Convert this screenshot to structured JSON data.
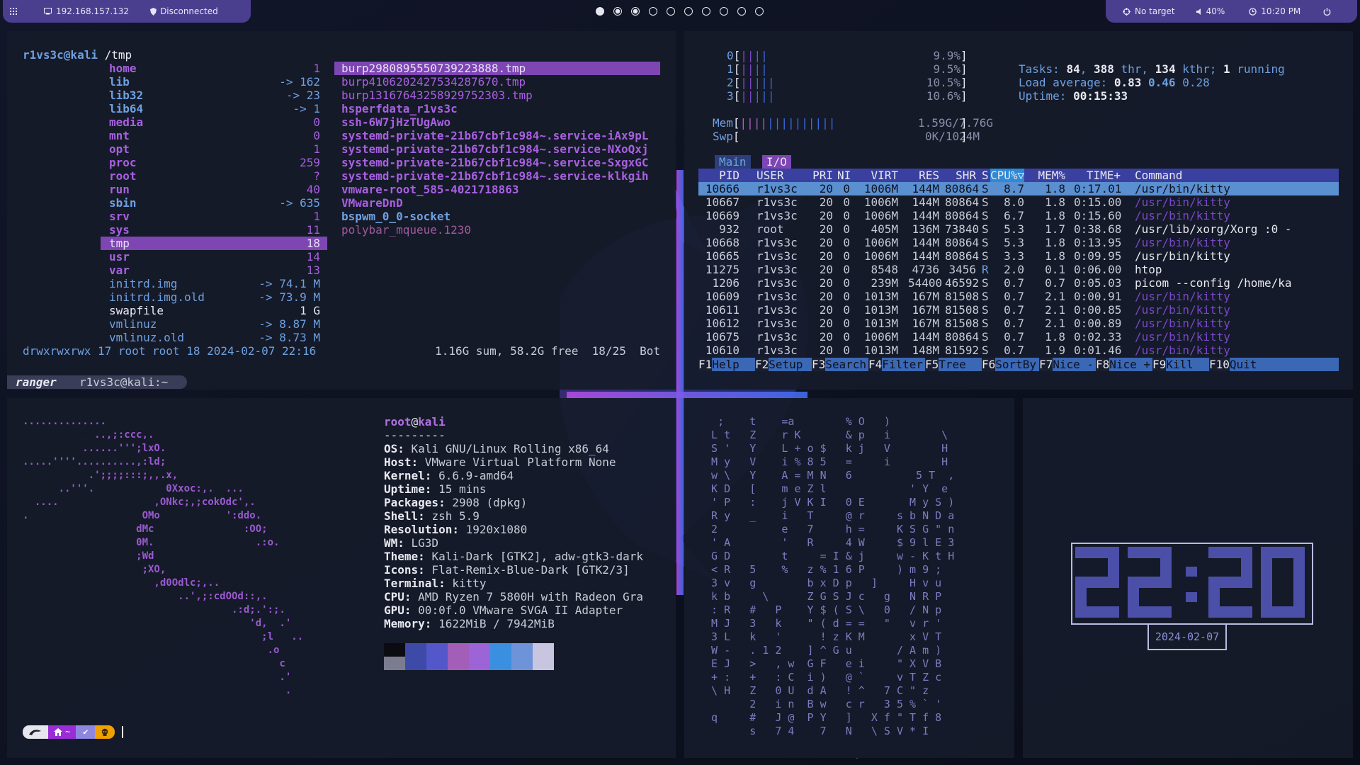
{
  "topbar": {
    "ip": "192.168.157.132",
    "vpn": "Disconnected",
    "target": "No target",
    "volume": "40%",
    "time": "10:20 PM",
    "workspaces": 10
  },
  "ranger": {
    "prompt_user": "r1vs3c@kali",
    "prompt_path": "/tmp",
    "left": [
      [
        "home",
        "1"
      ],
      [
        "lib",
        "-> 162"
      ],
      [
        "lib32",
        "-> 23"
      ],
      [
        "lib64",
        "-> 1"
      ],
      [
        "media",
        "0"
      ],
      [
        "mnt",
        "0"
      ],
      [
        "opt",
        "1"
      ],
      [
        "proc",
        "259"
      ],
      [
        "root",
        "?"
      ],
      [
        "run",
        "40"
      ],
      [
        "sbin",
        "-> 635"
      ],
      [
        "srv",
        "1"
      ],
      [
        "sys",
        "11"
      ],
      [
        "tmp",
        "18"
      ],
      [
        "usr",
        "14"
      ],
      [
        "var",
        "13"
      ],
      [
        "initrd.img",
        "-> 74.1 M"
      ],
      [
        "initrd.img.old",
        "-> 73.9 M"
      ],
      [
        "swapfile",
        "1 G"
      ],
      [
        "vmlinuz",
        "-> 8.87 M"
      ],
      [
        "vmlinuz.old",
        "-> 8.73 M"
      ]
    ],
    "right": [
      "burp2980895550739223888.tmp",
      "burp4106202427534287670.tmp",
      "burp13167643258929752303.tmp",
      "hsperfdata_r1vs3c",
      "ssh-6W7jHzTUgAwo",
      "systemd-private-21b67cbf1c984~.service-iAx9pL",
      "systemd-private-21b67cbf1c984~.service-NXoQxj",
      "systemd-private-21b67cbf1c984~.service-SxgxGC",
      "systemd-private-21b67cbf1c984~.service-klkgih",
      "vmware-root_585-4021718863",
      "VMwareDnD",
      "bspwm_0_0-socket",
      "polybar_mqueue.1230"
    ],
    "status_left": "drwxrwxrwx 17 root root 18 2024-02-07 22:16",
    "status_right": "1.16G sum, 58.2G free  18/25  Bot",
    "tab_name": "ranger",
    "tab_title": "r1vs3c@kali:~"
  },
  "htop": {
    "cpus": [
      [
        "0",
        "9.9%"
      ],
      [
        "1",
        "9.5%"
      ],
      [
        "2",
        "10.5%"
      ],
      [
        "3",
        "10.6%"
      ]
    ],
    "mem": "1.59G/7.76G",
    "swp": "0K/1024M",
    "tasks": "84",
    "thr": "388",
    "kthr": "134",
    "running": "1",
    "load1": "0.83",
    "load5": "0.46",
    "load15": "0.28",
    "uptime": "00:15:33",
    "tabs": [
      "Main",
      "I/O"
    ],
    "headers": [
      "PID",
      "USER",
      "PRI",
      "NI",
      "VIRT",
      "RES",
      "SHR",
      "S",
      "CPU%▽",
      "MEM%",
      "TIME+",
      "Command"
    ],
    "rows": [
      [
        "10666",
        "r1vs3c",
        "20",
        "0",
        "1006M",
        "144M",
        "80864",
        "S",
        "8.7",
        "1.8",
        "0:17.01",
        "/usr/bin/kitty"
      ],
      [
        "10667",
        "r1vs3c",
        "20",
        "0",
        "1006M",
        "144M",
        "80864",
        "S",
        "8.0",
        "1.8",
        "0:15.00",
        "/usr/bin/kitty"
      ],
      [
        "10669",
        "r1vs3c",
        "20",
        "0",
        "1006M",
        "144M",
        "80864",
        "S",
        "6.7",
        "1.8",
        "0:15.60",
        "/usr/bin/kitty"
      ],
      [
        "932",
        "root",
        "20",
        "0",
        "405M",
        "136M",
        "73840",
        "S",
        "5.3",
        "1.7",
        "0:38.68",
        "/usr/lib/xorg/Xorg :0 -"
      ],
      [
        "10668",
        "r1vs3c",
        "20",
        "0",
        "1006M",
        "144M",
        "80864",
        "S",
        "5.3",
        "1.8",
        "0:13.95",
        "/usr/bin/kitty"
      ],
      [
        "10665",
        "r1vs3c",
        "20",
        "0",
        "1006M",
        "144M",
        "80864",
        "S",
        "3.3",
        "1.8",
        "0:09.95",
        "/usr/bin/kitty"
      ],
      [
        "11275",
        "r1vs3c",
        "20",
        "0",
        "8548",
        "4736",
        "3456",
        "R",
        "2.0",
        "0.1",
        "0:06.00",
        "htop"
      ],
      [
        "1206",
        "r1vs3c",
        "20",
        "0",
        "239M",
        "54400",
        "46592",
        "S",
        "0.7",
        "0.7",
        "0:05.03",
        "picom --config /home/ka"
      ],
      [
        "10609",
        "r1vs3c",
        "20",
        "0",
        "1013M",
        "167M",
        "81508",
        "S",
        "0.7",
        "2.1",
        "0:00.91",
        "/usr/bin/kitty"
      ],
      [
        "10611",
        "r1vs3c",
        "20",
        "0",
        "1013M",
        "167M",
        "81508",
        "S",
        "0.7",
        "2.1",
        "0:00.85",
        "/usr/bin/kitty"
      ],
      [
        "10612",
        "r1vs3c",
        "20",
        "0",
        "1013M",
        "167M",
        "81508",
        "S",
        "0.7",
        "2.1",
        "0:00.89",
        "/usr/bin/kitty"
      ],
      [
        "10675",
        "r1vs3c",
        "20",
        "0",
        "1006M",
        "144M",
        "80864",
        "S",
        "0.7",
        "1.8",
        "0:02.33",
        "/usr/bin/kitty"
      ],
      [
        "10610",
        "r1vs3c",
        "20",
        "0",
        "1013M",
        "148M",
        "81592",
        "S",
        "0.7",
        "1.9",
        "0:01.46",
        "/usr/bin/kitty"
      ]
    ],
    "fkeys": [
      [
        "F1",
        "Help"
      ],
      [
        "F2",
        "Setup"
      ],
      [
        "F3",
        "Search"
      ],
      [
        "F4",
        "Filter"
      ],
      [
        "F5",
        "Tree"
      ],
      [
        "F6",
        "SortBy"
      ],
      [
        "F7",
        "Nice -"
      ],
      [
        "F8",
        "Nice +"
      ],
      [
        "F9",
        "Kill"
      ],
      [
        "F10",
        "Quit"
      ]
    ]
  },
  "neofetch": {
    "logo": [
      "..............",
      "            ..,;:ccc,.",
      "          ......''';lxO.",
      ".....''''..........,:ld;",
      "           .';;;;:::;,,.x,",
      "      ..'''.            0Xxoc:,.  ...",
      "  ....                ,ONkc;,;cokOdc',.",
      ".                   OMo           ':ddo.",
      "                   dMc               :OO;",
      "                   0M.                 .:o.",
      "                   ;Wd",
      "                    ;XO,",
      "                      ,d0Odlc;,..",
      "                          ..',;:cdOOd::,.",
      "                                   .:d;.':;.",
      "                                      'd,  .'",
      "                                        ;l   ..",
      "                                         .o",
      "                                           c",
      "                                           .'",
      "                                            ."
    ],
    "user": "root",
    "host": "kali",
    "sep": "---------",
    "info": [
      [
        "OS",
        "Kali GNU/Linux Rolling x86_64"
      ],
      [
        "Host",
        "VMware Virtual Platform None"
      ],
      [
        "Kernel",
        "6.6.9-amd64"
      ],
      [
        "Uptime",
        "15 mins"
      ],
      [
        "Packages",
        "2908 (dpkg)"
      ],
      [
        "Shell",
        "zsh 5.9"
      ],
      [
        "Resolution",
        "1920x1080"
      ],
      [
        "WM",
        "LG3D"
      ],
      [
        "Theme",
        "Kali-Dark [GTK2], adw-gtk3-dark"
      ],
      [
        "Icons",
        "Flat-Remix-Blue-Dark [GTK2/3]"
      ],
      [
        "Terminal",
        "kitty"
      ],
      [
        "CPU",
        "AMD Ryzen 7 5800H with Radeon Gra"
      ],
      [
        "GPU",
        "00:0f.0 VMware SVGA II Adapter"
      ],
      [
        "Memory",
        "1622MiB / 7942MiB"
      ]
    ],
    "palette": [
      "#0b0b12",
      "#3d4aa8",
      "#5457c9",
      "#a35fb8",
      "#9c64d6",
      "#3b8fe0",
      "#6e93d8",
      "#c7c5e0"
    ],
    "palette_low": [
      "#7c7c90",
      "#3d4aa8",
      "#5457c9",
      "#a35fb8",
      "#9c64d6",
      "#3b8fe0",
      "#6e93d8",
      "#c7c5e0"
    ],
    "prompt": {
      "dir": "~",
      "check": "✔"
    }
  },
  "matrix": [
    "   ;    t    =a        % O   )",
    "  L t   Z    r K       & p   i        \\",
    "  S '   Y    L + o $   k j   V        H",
    "  M y   V    i % 8 5   =     i        H",
    "  w \\   Y    A = M N   6          5 T  ,",
    "  K D   [    m e Z l             ' Y  e",
    "  ' P   :    j V K I   0 E       M y S )",
    "  R y   _    i   T     @ r     s b N D a",
    "  2          e   7     h =     K S G \" n",
    "  ' A        '   R     4 W     $ 9 l E 3",
    "  G D        t     = I & j     w - K t H",
    "  < R   5    %   z % 1 6 P     ) m 9 ;",
    "  3 v   g        b x D p   ]     H v u",
    "  k b     \\      Z G S J c   g   N R P",
    "  : R   #   P    Y $ ( S \\   0   / N p",
    "  M J   3   k    \" ( d = =   \"   v r '",
    "  3 L   k   '      ! z K M       x V T",
    "  W -   . 1 2    ] ^ G u       / A m )",
    "  E J   >   , w  G F   e i     \" X V B",
    "  + :   +   : C  i )   @ `     v T Z c",
    "  \\ H   Z   0 U  d A   ! ^   7 C \" z",
    "        2   i n  B w   c r   3 5 % ` '",
    "  q     #   J @  P Y   ]   X f \" T f 8",
    "        s   7 4    7   N   \\ S V * I"
  ],
  "clock": {
    "time": "22:20",
    "date": "2024-02-07"
  }
}
